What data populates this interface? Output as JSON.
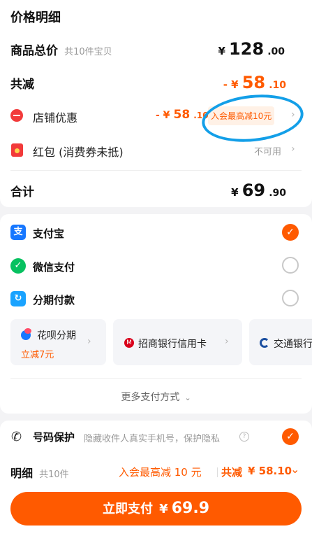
{
  "price_detail": {
    "title": "价格明细",
    "total_label": "商品总价",
    "total_count": "共10件宝贝",
    "total_currency": "¥",
    "total_int": "128",
    "total_dec": ".00",
    "discount_label": "共减",
    "discount_currency": "- ¥",
    "discount_int": "58",
    "discount_dec": ".10",
    "shop_label": "店铺优惠",
    "shop_currency": "- ¥",
    "shop_int": "58",
    "shop_dec": ".10",
    "shop_badge": "入会最高减10元",
    "redpacket_label": "红包 (消费券未抵)",
    "redpacket_status": "不可用",
    "sum_label": "合计",
    "sum_currency": "¥",
    "sum_int": "69",
    "sum_dec": ".90"
  },
  "payment": {
    "alipay": "支付宝",
    "wechat": "微信支付",
    "installment": "分期付款",
    "huabei_title": "花呗分期",
    "huabei_sub": "立减7元",
    "cmb": "招商银行信用卡",
    "bocom": "交通银行",
    "more": "更多支付方式"
  },
  "privacy": {
    "label": "号码保护",
    "desc": "隐藏收件人真实手机号，保护隐私"
  },
  "bottom": {
    "detail_label": "明细",
    "detail_count": "共10件",
    "promo": "入会最高减 10 元",
    "discount_label": "共减",
    "discount_value": "¥ 58.10",
    "pay_label": "立即支付",
    "pay_currency": "¥",
    "pay_value": "69.9"
  },
  "colors": {
    "accent": "#ff5a00",
    "alipay": "#1677ff",
    "wechat": "#07c160",
    "annotation": "#139fe8"
  },
  "icons": {
    "shop": "shop-discount-icon",
    "redpacket": "red-packet-icon",
    "alipay": "alipay-icon",
    "wechat": "wechat-pay-icon",
    "installment": "installment-icon",
    "phone": "phone-icon",
    "help": "help-icon"
  }
}
